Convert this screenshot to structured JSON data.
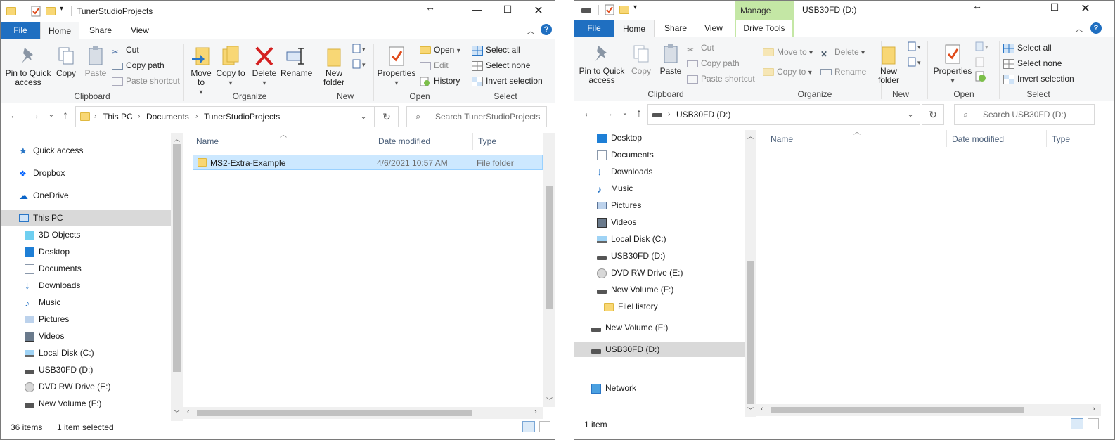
{
  "colors": {
    "accent": "#1f6fc1",
    "selection": "#cce8ff",
    "manage_tab": "#c4e7a5",
    "folder": "#f8d775"
  },
  "left": {
    "title": "TunerStudioProjects",
    "tabs": {
      "file": "File",
      "home": "Home",
      "share": "Share",
      "view": "View"
    },
    "ribbon": {
      "pin": "Pin to Quick access",
      "copy": "Copy",
      "paste": "Paste",
      "cut": "Cut",
      "copy_path": "Copy path",
      "paste_shortcut": "Paste shortcut",
      "move_to": "Move to",
      "copy_to": "Copy to",
      "delete": "Delete",
      "rename": "Rename",
      "new_folder": "New folder",
      "properties": "Properties",
      "open": "Open",
      "edit": "Edit",
      "history": "History",
      "select_all": "Select all",
      "select_none": "Select none",
      "invert_selection": "Invert selection",
      "groups": {
        "clipboard": "Clipboard",
        "organize": "Organize",
        "new": "New",
        "open": "Open",
        "select": "Select"
      }
    },
    "breadcrumb": [
      "This PC",
      "Documents",
      "TunerStudioProjects"
    ],
    "search_placeholder": "Search TunerStudioProjects",
    "nav": [
      "Quick access",
      "Dropbox",
      "OneDrive",
      "This PC",
      "3D Objects",
      "Desktop",
      "Documents",
      "Downloads",
      "Music",
      "Pictures",
      "Videos",
      "Local Disk (C:)",
      "USB30FD (D:)",
      "DVD RW Drive (E:)",
      "New Volume (F:)"
    ],
    "columns": {
      "name": "Name",
      "date": "Date modified",
      "type": "Type"
    },
    "rows": [
      {
        "name": "MS2-Extra-Example",
        "date": "4/6/2021 10:57 AM",
        "type": "File folder"
      }
    ],
    "status": {
      "items": "36 items",
      "selected": "1 item selected"
    }
  },
  "right": {
    "title": "USB30FD (D:)",
    "manage": "Manage",
    "tabs": {
      "file": "File",
      "home": "Home",
      "share": "Share",
      "view": "View",
      "drive_tools": "Drive Tools"
    },
    "ribbon": {
      "pin": "Pin to Quick access",
      "copy": "Copy",
      "paste": "Paste",
      "cut": "Cut",
      "copy_path": "Copy path",
      "paste_shortcut": "Paste shortcut",
      "move_to": "Move to",
      "copy_to": "Copy to",
      "delete": "Delete",
      "rename": "Rename",
      "new_folder": "New folder",
      "properties": "Properties",
      "select_all": "Select all",
      "select_none": "Select none",
      "invert_selection": "Invert selection",
      "groups": {
        "clipboard": "Clipboard",
        "organize": "Organize",
        "new": "New",
        "open": "Open",
        "select": "Select"
      }
    },
    "breadcrumb": [
      "USB30FD (D:)"
    ],
    "search_placeholder": "Search USB30FD (D:)",
    "nav": [
      "Desktop",
      "Documents",
      "Downloads",
      "Music",
      "Pictures",
      "Videos",
      "Local Disk (C:)",
      "USB30FD (D:)",
      "DVD RW Drive (E:)",
      "New Volume (F:)",
      "FileHistory",
      "New Volume (F:)",
      "USB30FD (D:)",
      "Network"
    ],
    "columns": {
      "name": "Name",
      "date": "Date modified",
      "type": "Type"
    },
    "status": {
      "items": "1 item"
    }
  }
}
